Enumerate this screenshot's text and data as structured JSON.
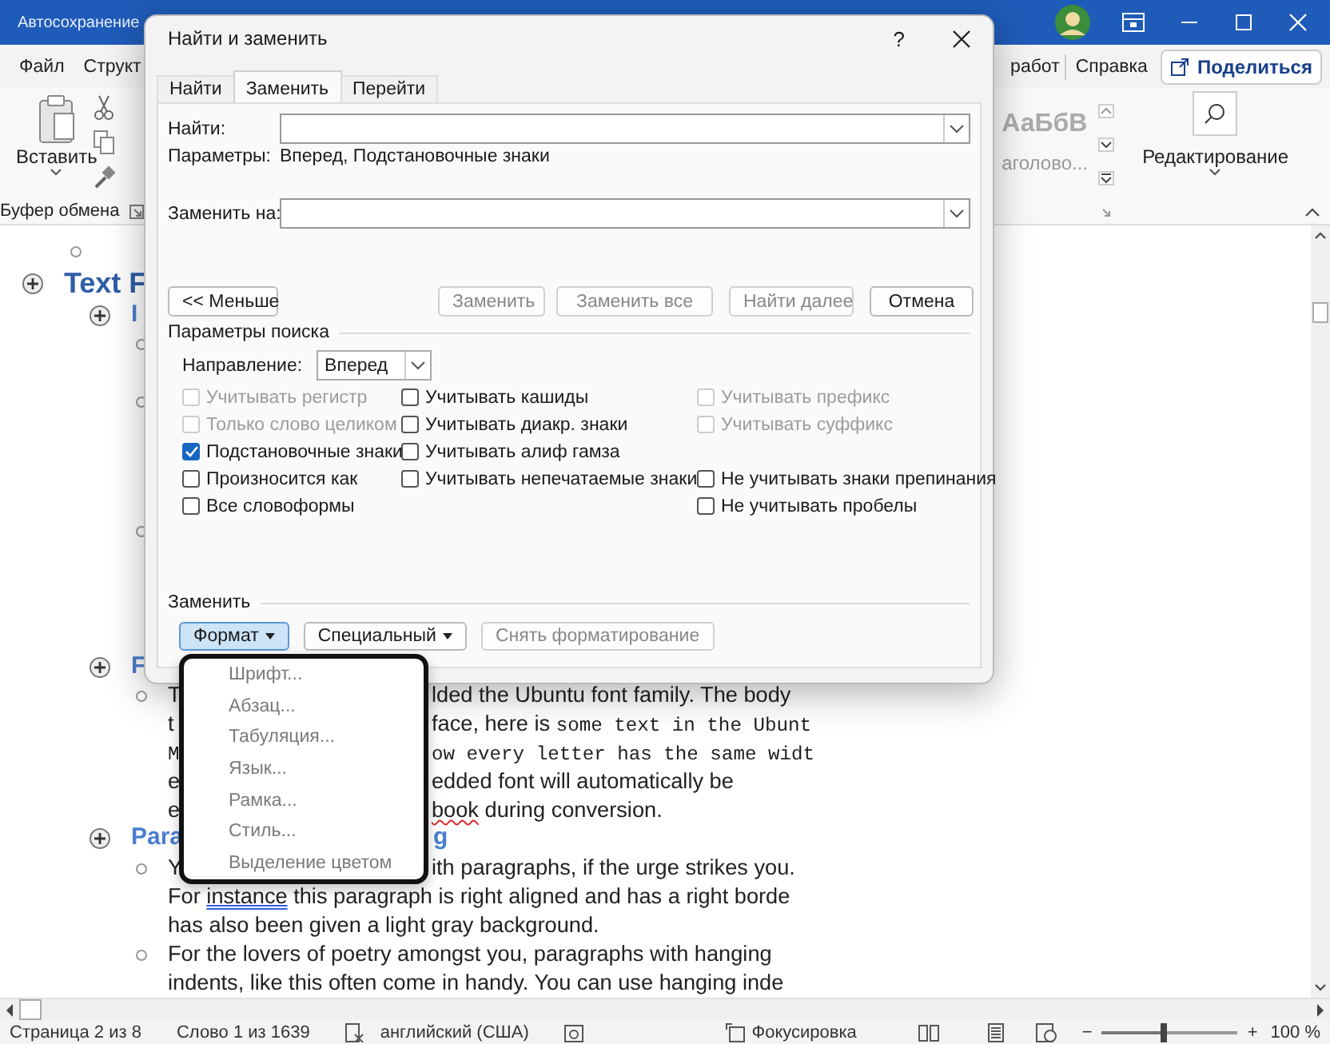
{
  "app": {
    "autosave_label": "Автосохранение",
    "menu_left": [
      "Файл",
      "Структ"
    ],
    "menu_right": [
      "работ",
      "Справка"
    ],
    "share_button": "Поделиться"
  },
  "ribbon": {
    "paste_label": "Вставить",
    "clipboard_group": "Буфер обмена",
    "style_preview": "АаБбВ",
    "style_name": "аголово...",
    "editing_label": "Редактирование"
  },
  "document": {
    "rows": [
      {
        "kind": "subbullet"
      },
      {
        "kind": "heading",
        "left": [
          {
            "text": "Text F",
            "kind": "plain"
          }
        ]
      },
      {
        "kind": "section",
        "left": [
          {
            "text": "I",
            "kind": "plain"
          }
        ]
      },
      {
        "kind": "bullet"
      },
      {
        "kind": "bullet"
      },
      {
        "kind": "bullet"
      },
      {
        "kind": "section",
        "left": [
          {
            "text": "F",
            "kind": "plain"
          }
        ]
      },
      {
        "kind": "bullet",
        "left": [
          {
            "text": "T",
            "kind": "plain"
          }
        ],
        "right": [
          {
            "text": "lded the Ubuntu font family. The body",
            "kind": "plain"
          }
        ]
      },
      {
        "kind": "line",
        "left": [
          {
            "text": "t",
            "kind": "plain"
          }
        ],
        "right": [
          {
            "text": "face, here is ",
            "kind": "plain"
          },
          {
            "text": "some text in the Ubunt",
            "kind": "mono"
          }
        ]
      },
      {
        "kind": "line",
        "left": [
          {
            "text": "M",
            "kind": "mono"
          }
        ],
        "right": [
          {
            "text": "ow every letter has the same widt",
            "kind": "mono"
          }
        ]
      },
      {
        "kind": "line",
        "left": [
          {
            "text": "e",
            "kind": "plain"
          }
        ],
        "right": [
          {
            "text": "edded font will automatically be",
            "kind": "plain"
          }
        ]
      },
      {
        "kind": "line",
        "left": [
          {
            "text": "e",
            "kind": "plain"
          }
        ],
        "right": [
          {
            "text": "book",
            "kind": "spelling"
          },
          {
            "text": " during conversion.",
            "kind": "plain"
          }
        ]
      },
      {
        "kind": "section",
        "left": [
          {
            "text": "Para",
            "kind": "plain"
          }
        ],
        "right": [
          {
            "text": "g",
            "kind": "plain"
          }
        ]
      },
      {
        "kind": "bullet",
        "left": [
          {
            "text": "Y",
            "kind": "plain"
          }
        ],
        "right": [
          {
            "text": "ith paragraphs, if the urge strikes you.",
            "kind": "plain"
          }
        ]
      },
      {
        "kind": "line",
        "left": [
          {
            "text": "For ",
            "kind": "plain"
          },
          {
            "text": "instance",
            "kind": "grammar"
          },
          {
            "text": " this paragraph is right aligned and has a right borde",
            "kind": "plain"
          }
        ]
      },
      {
        "kind": "line",
        "left": [
          {
            "text": "has also been given a light gray background.",
            "kind": "plain"
          }
        ]
      },
      {
        "kind": "bullet",
        "left": [
          {
            "text": "For the lovers of poetry amongst you, paragraphs with hanging",
            "kind": "plain"
          }
        ]
      },
      {
        "kind": "line",
        "left": [
          {
            "text": "indents, like this often come in handy. You can use hanging inde",
            "kind": "plain"
          }
        ]
      }
    ]
  },
  "dialog": {
    "title": "Найти и заменить",
    "help": "?",
    "tabs": [
      {
        "label": "Найти",
        "selected": false
      },
      {
        "label": "Заменить",
        "selected": true
      },
      {
        "label": "Перейти",
        "selected": false
      }
    ],
    "find_label": "Найти:",
    "params_label": "Параметры:",
    "params_value": "Вперед, Подстановочные знаки",
    "replace_label": "Заменить на:",
    "buttons": [
      {
        "label": "<< Меньше",
        "disabled": false
      },
      {
        "label": "Заменить",
        "disabled": true
      },
      {
        "label": "Заменить все",
        "disabled": true
      },
      {
        "label": "Найти далее",
        "disabled": true
      },
      {
        "label": "Отмена",
        "disabled": false
      }
    ],
    "search_section": "Параметры поиска",
    "direction_label": "Направление:",
    "direction_value": "Вперед",
    "option_columns": [
      {
        "groups": [
          [
            {
              "label": "Учитывать регистр",
              "checked": false,
              "disabled": true
            },
            {
              "label": "Только слово целиком",
              "checked": false,
              "disabled": true
            },
            {
              "label": "Подстановочные знаки",
              "checked": true,
              "disabled": false
            },
            {
              "label": "Произносится как",
              "checked": false,
              "disabled": false
            },
            {
              "label": "Все словоформы",
              "checked": false,
              "disabled": false
            }
          ]
        ]
      },
      {
        "groups": [
          [
            {
              "label": "Учитывать кашиды",
              "checked": false,
              "disabled": false
            },
            {
              "label": "Учитывать диакр. знаки",
              "checked": false,
              "disabled": false
            },
            {
              "label": "Учитывать алиф гамза",
              "checked": false,
              "disabled": false
            },
            {
              "label": "Учитывать непечатаемые знаки",
              "checked": false,
              "disabled": false
            }
          ]
        ]
      },
      {
        "groups": [
          [
            {
              "label": "Учитывать префикс",
              "checked": false,
              "disabled": true
            },
            {
              "label": "Учитывать суффикс",
              "checked": false,
              "disabled": true
            }
          ],
          [
            {
              "label": "Не учитывать знаки препинания",
              "checked": false,
              "disabled": false
            },
            {
              "label": "Не учитывать пробелы",
              "checked": false,
              "disabled": false
            }
          ]
        ]
      }
    ],
    "replace_section": "Заменить",
    "format_buttons": [
      {
        "label": "Формат",
        "dropdown": true,
        "pressed": true,
        "disabled": false
      },
      {
        "label": "Специальный",
        "dropdown": true,
        "pressed": false,
        "disabled": false
      },
      {
        "label": "Снять форматирование",
        "dropdown": false,
        "pressed": false,
        "disabled": true
      }
    ]
  },
  "format_menu": {
    "items": [
      "Шрифт...",
      "Абзац...",
      "Табуляция...",
      "Язык...",
      "Рамка...",
      "Стиль...",
      "Выделение цветом"
    ]
  },
  "status_bar": {
    "page": "Страница 2 из 8",
    "words": "Слово 1 из 1639",
    "language": "английский (США)",
    "focus": "Фокусировка",
    "zoom_out": "−",
    "zoom_in": "+",
    "zoom": {
      "level": 0.45
    },
    "zoom_value": "100 %"
  }
}
